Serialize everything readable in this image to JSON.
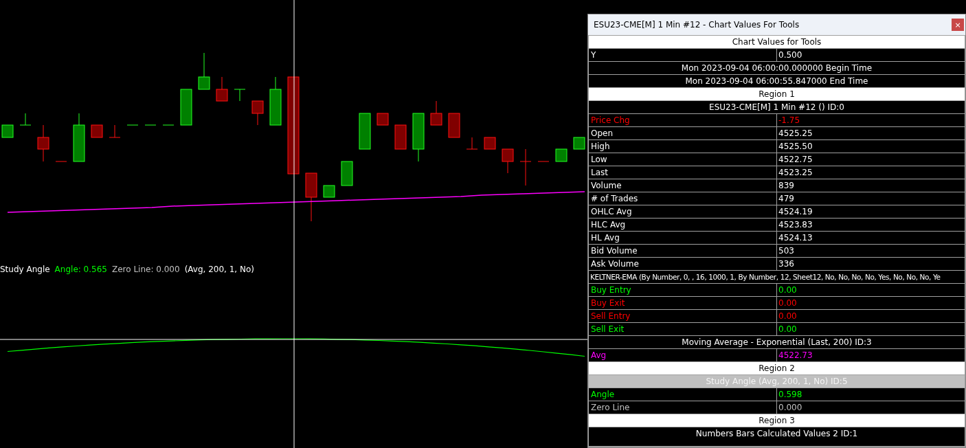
{
  "chart_legend": {
    "title": "Study Angle",
    "items": [
      {
        "text": "Angle: 0.565",
        "color": "#00ff00"
      },
      {
        "text": "Zero Line: 0.000",
        "color": "#c0c0c0"
      },
      {
        "text": "(Avg, 200, 1, No)",
        "color": "#ffffff"
      }
    ]
  },
  "window": {
    "title": "ESU23-CME[M]  1 Min  #12 - Chart Values For Tools",
    "close": "×"
  },
  "rows": [
    {
      "kind": "header",
      "text": "Chart Values for Tools"
    },
    {
      "kind": "pair",
      "label": "Y",
      "value": "0.500",
      "color": "#ffffff"
    },
    {
      "kind": "title",
      "text": "Mon 2023-09-04  06:00:00.000000 Begin Time",
      "selected": false
    },
    {
      "kind": "title",
      "text": "Mon 2023-09-04  06:00:55.847000 End Time",
      "selected": false
    },
    {
      "kind": "header",
      "text": "Region 1"
    },
    {
      "kind": "title",
      "text": "ESU23-CME[M]  1 Min  #12 ()   ID:0",
      "selected": false
    },
    {
      "kind": "pair",
      "label": "Price Chg",
      "value": "-1.75",
      "color": "#ff0000"
    },
    {
      "kind": "pair",
      "label": "Open",
      "value": "4525.25",
      "color": "#ffffff"
    },
    {
      "kind": "pair",
      "label": "High",
      "value": "4525.50",
      "color": "#ffffff"
    },
    {
      "kind": "pair",
      "label": "Low",
      "value": "4522.75",
      "color": "#ffffff"
    },
    {
      "kind": "pair",
      "label": "Last",
      "value": "4523.25",
      "color": "#ffffff"
    },
    {
      "kind": "pair",
      "label": "Volume",
      "value": "839",
      "color": "#ffffff"
    },
    {
      "kind": "pair",
      "label": "# of Trades",
      "value": "479",
      "color": "#ffffff"
    },
    {
      "kind": "pair",
      "label": "OHLC Avg",
      "value": "4524.19",
      "color": "#ffffff"
    },
    {
      "kind": "pair",
      "label": "HLC Avg",
      "value": "4523.83",
      "color": "#ffffff"
    },
    {
      "kind": "pair",
      "label": "HL Avg",
      "value": "4524.13",
      "color": "#ffffff"
    },
    {
      "kind": "pair",
      "label": "Bid Volume",
      "value": "503",
      "color": "#ffffff"
    },
    {
      "kind": "pair",
      "label": "Ask Volume",
      "value": "336",
      "color": "#ffffff"
    },
    {
      "kind": "text",
      "text": "KELTNER-EMA (By Number, 0, , 16, 1000, 1, By Number, 12, Sheet12, No, No, No, No, Yes, No, No, No, Ye"
    },
    {
      "kind": "pair",
      "label": "Buy Entry",
      "value": "0.00",
      "color": "#00ff00"
    },
    {
      "kind": "pair",
      "label": "Buy Exit",
      "value": "0.00",
      "color": "#ff0000"
    },
    {
      "kind": "pair",
      "label": "Sell Entry",
      "value": "0.00",
      "color": "#ff0000"
    },
    {
      "kind": "pair",
      "label": "Sell Exit",
      "value": "0.00",
      "color": "#00ff00"
    },
    {
      "kind": "title",
      "text": "Moving Average - Exponential (Last, 200)   ID:3",
      "selected": false
    },
    {
      "kind": "pair",
      "label": "Avg",
      "value": "4522.73",
      "color": "#ff00ff"
    },
    {
      "kind": "header",
      "text": "Region 2"
    },
    {
      "kind": "title",
      "text": "Study Angle (Avg, 200, 1, No)   ID:5",
      "selected": true
    },
    {
      "kind": "pair",
      "label": "Angle",
      "value": "0.598",
      "color": "#00ff00"
    },
    {
      "kind": "pair",
      "label": "Zero Line",
      "value": "0.000",
      "color": "#c0c0c0"
    },
    {
      "kind": "header",
      "text": "Region 3"
    },
    {
      "kind": "title",
      "text": "Numbers Bars Calculated Values 2 ID:1",
      "selected": false
    }
  ]
}
